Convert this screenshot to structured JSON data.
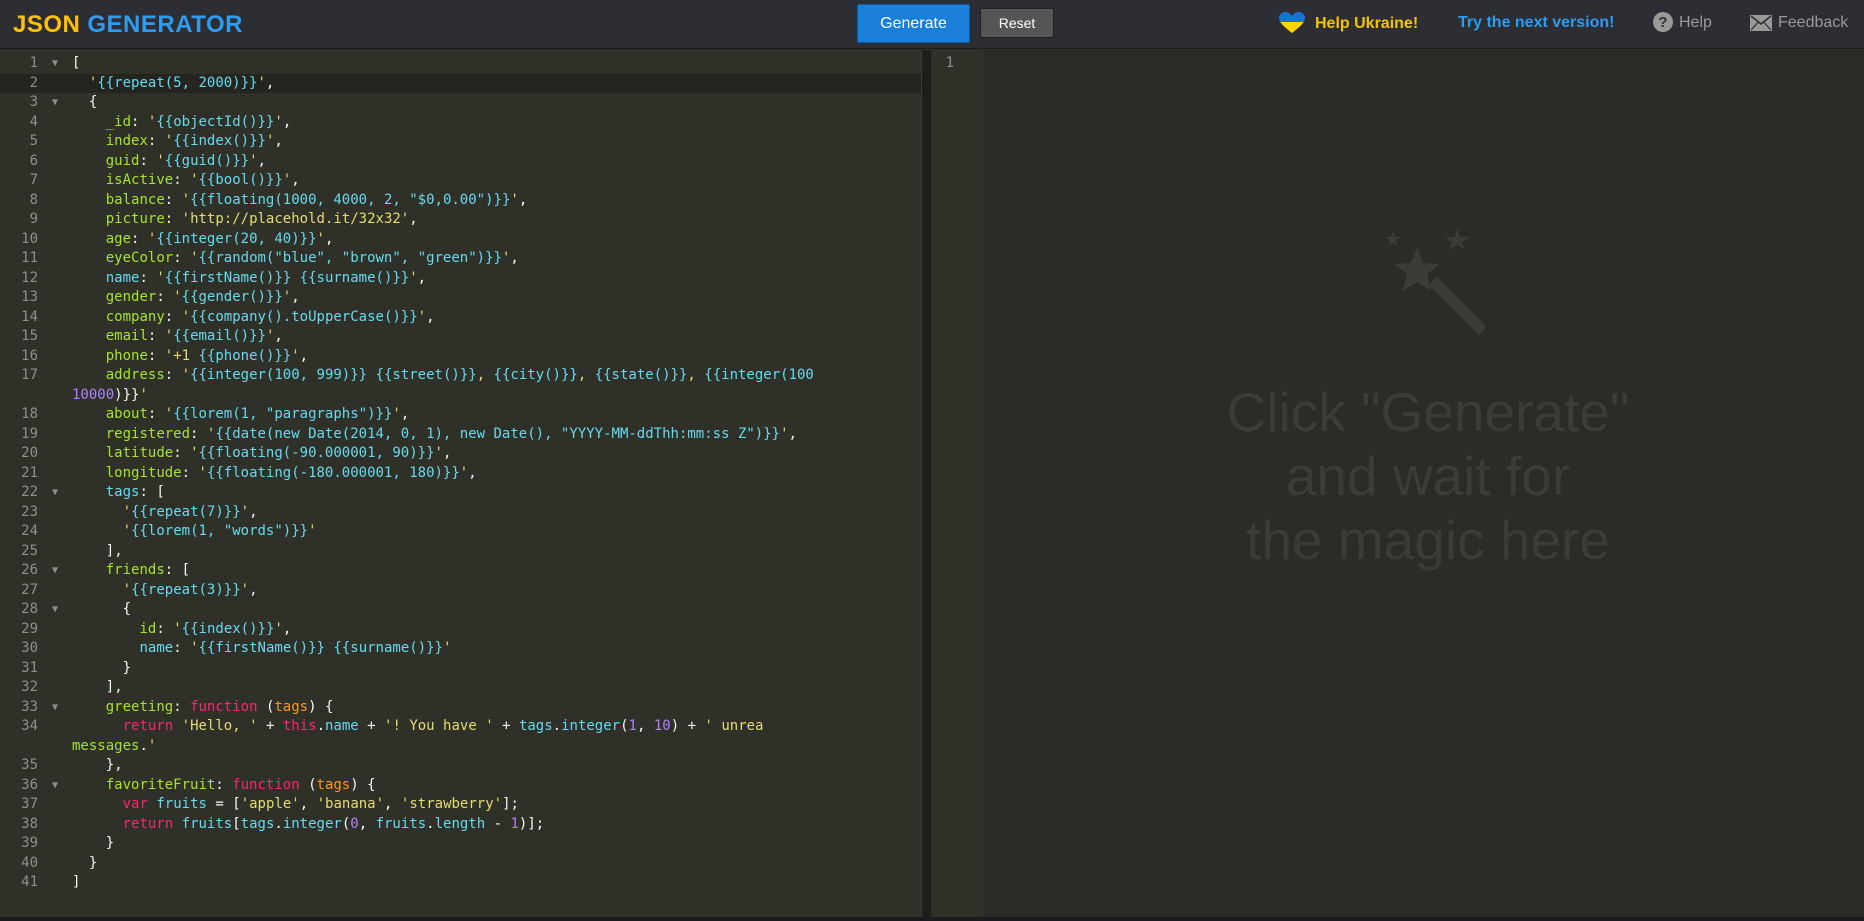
{
  "header": {
    "logo_part1": "JSON",
    "logo_part2": "GENERATOR",
    "generate_label": "Generate",
    "reset_label": "Reset",
    "help_ukraine": "Help Ukraine!",
    "next_version": "Try the next version!",
    "help": "Help",
    "feedback": "Feedback"
  },
  "output": {
    "line_number": "1",
    "placeholder_line1": "Click \"Generate\"",
    "placeholder_line2": "and wait for",
    "placeholder_line3": "the magic here"
  },
  "editor": {
    "line_numbers": [
      "1",
      "2",
      "3",
      "4",
      "5",
      "6",
      "7",
      "8",
      "9",
      "10",
      "11",
      "12",
      "13",
      "14",
      "15",
      "16",
      "17",
      "18",
      "19",
      "20",
      "21",
      "22",
      "23",
      "24",
      "25",
      "26",
      "27",
      "28",
      "29",
      "30",
      "31",
      "32",
      "33",
      "34",
      "35",
      "36",
      "37",
      "38",
      "39",
      "40",
      "41"
    ],
    "lines": [
      "[",
      "  '{{repeat(5, 2000)}}',",
      "  {",
      "    _id: '{{objectId()}}',",
      "    index: '{{index()}}',",
      "    guid: '{{guid()}}',",
      "    isActive: '{{bool()}}',",
      "    balance: '{{floating(1000, 4000, 2, \"$0,0.00\")}}',",
      "    picture: 'http://placehold.it/32x32',",
      "    age: '{{integer(20, 40)}}',",
      "    eyeColor: '{{random(\"blue\", \"brown\", \"green\")}}',",
      "    name: '{{firstName()}} {{surname()}}',",
      "    gender: '{{gender()}}',",
      "    company: '{{company().toUpperCase()}}',",
      "    email: '{{email()}}',",
      "    phone: '+1 {{phone()}}',",
      "    address: '{{integer(100, 999)}} {{street()}}, {{city()}}, {{state()}}, {{integer(100,",
      "10000)}}',",
      "    about: '{{lorem(1, \"paragraphs\")}}',",
      "    registered: '{{date(new Date(2014, 0, 1), new Date(), \"YYYY-MM-ddThh:mm:ss Z\")}}',",
      "    latitude: '{{floating(-90.000001, 90)}}',",
      "    longitude: '{{floating(-180.000001, 180)}}',",
      "    tags: [",
      "      '{{repeat(7)}}',",
      "      '{{lorem(1, \"words\")}}'",
      "    ],",
      "    friends: [",
      "      '{{repeat(3)}}',",
      "      {",
      "        id: '{{index()}}',",
      "        name: '{{firstName()}} {{surname()}}'",
      "      }",
      "    ],",
      "    greeting: function (tags) {",
      "      return 'Hello, ' + this.name + '! You have ' + tags.integer(1, 10) + ' unread",
      "messages.';",
      "    },",
      "    favoriteFruit: function (tags) {",
      "      var fruits = ['apple', 'banana', 'strawberry'];",
      "      return fruits[tags.integer(0, fruits.length - 1)];",
      "    }",
      "  }",
      "]"
    ]
  }
}
